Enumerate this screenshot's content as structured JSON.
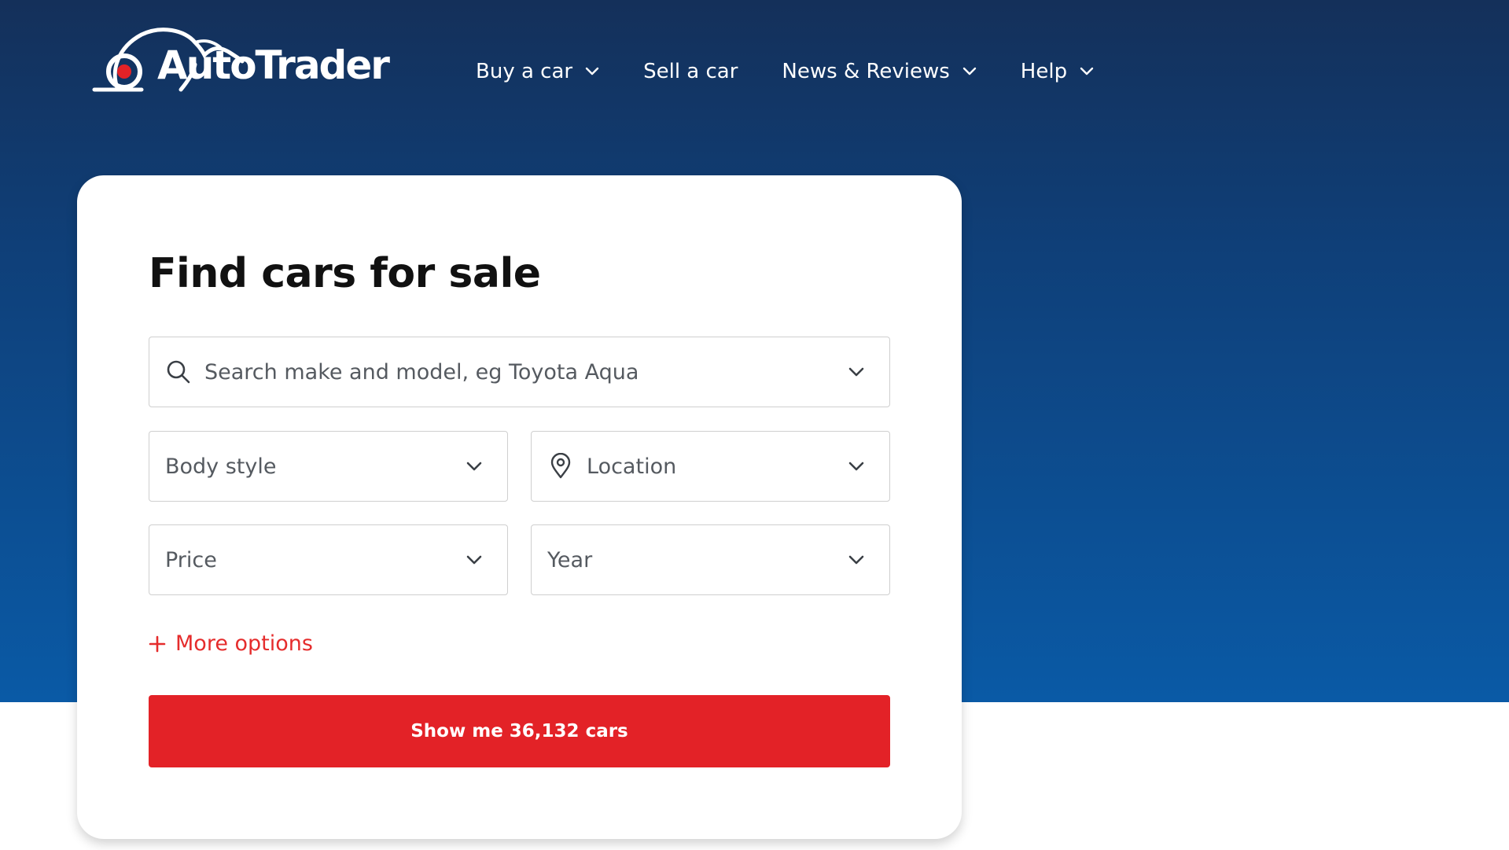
{
  "brand": {
    "name": "AutoTrader",
    "accent_red": "#e32227",
    "hero_top": "#14305a",
    "hero_bottom": "#0a5aa6"
  },
  "nav": {
    "items": [
      {
        "label": "Buy a car",
        "has_dropdown": true,
        "icon": "chevron-down-icon"
      },
      {
        "label": "Sell a car",
        "has_dropdown": false
      },
      {
        "label": "News & Reviews",
        "has_dropdown": true,
        "icon": "chevron-down-icon"
      },
      {
        "label": "Help",
        "has_dropdown": true,
        "icon": "chevron-down-icon"
      }
    ]
  },
  "search_card": {
    "title": "Find cars for sale",
    "search": {
      "placeholder": "Search make and model, eg Toyota Aqua",
      "icon": "search-icon"
    },
    "body_style": {
      "label": "Body style"
    },
    "location": {
      "label": "Location",
      "icon": "location-pin-icon"
    },
    "price": {
      "label": "Price"
    },
    "year": {
      "label": "Year"
    },
    "more_options": {
      "label": "More options",
      "icon": "plus-icon"
    },
    "submit": {
      "label": "Show me 36,132 cars"
    }
  }
}
